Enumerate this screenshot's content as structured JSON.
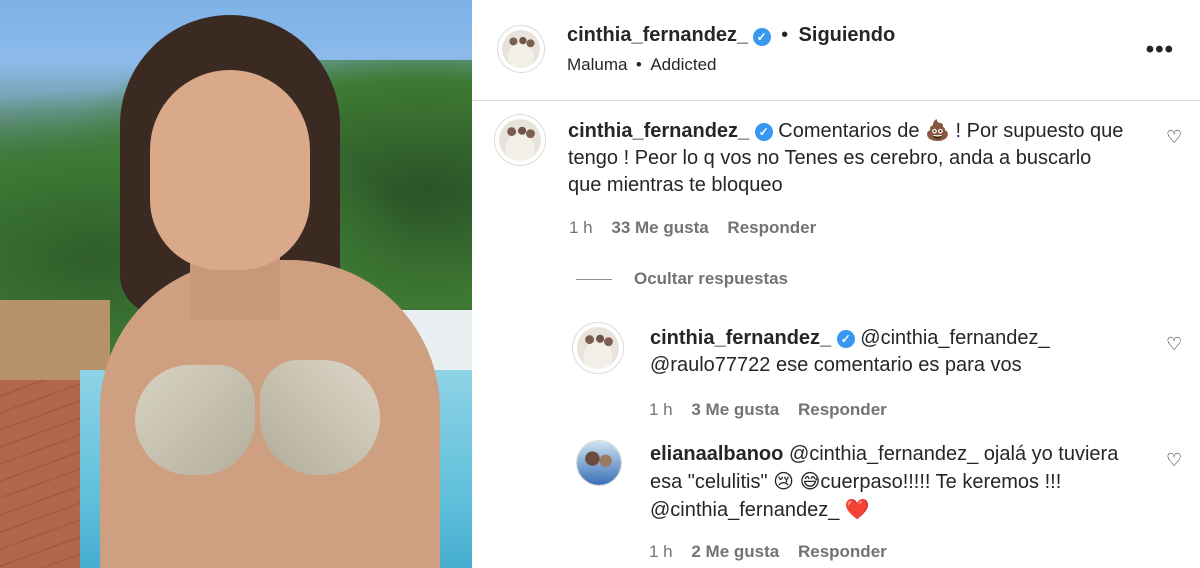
{
  "header": {
    "username": "cinthia_fernandez_",
    "separator": "•",
    "follow_label": "Siguiendo",
    "audio_artist": "Maluma",
    "audio_dot": "•",
    "audio_title": "Addicted",
    "more_label": "•••"
  },
  "comments": [
    {
      "username": "cinthia_fernandez_",
      "text_part1": "Comentarios de",
      "emoji1": "💩",
      "text_part2": "! Por supuesto que tengo ! Peor lo q vos no Tenes es cerebro, anda a buscarlo que mientras te bloqueo",
      "time": "1 h",
      "likes": "33 Me gusta",
      "reply": "Responder"
    }
  ],
  "replies_toggle": "Ocultar respuestas",
  "replies": [
    {
      "username": "cinthia_fernandez_",
      "text_part1": "@cinthia_fernandez_ @raulo77722 ese comentario es para vos",
      "time": "1 h",
      "likes": "3 Me gusta",
      "reply": "Responder"
    },
    {
      "username": "elianaalbanoo",
      "text_part1": "@cinthia_fernandez_ ojalá yo tuviera esa \"celulitis\"",
      "emoji1": "😢",
      "emoji2": "😅",
      "text_part2": "cuerpaso!!!!! Te keremos !!!",
      "text_part3": "@cinthia_fernandez_",
      "emoji3": "❤️",
      "time": "1 h",
      "likes": "2 Me gusta",
      "reply": "Responder"
    }
  ],
  "icons": {
    "verified": "✓",
    "heart": "♡"
  }
}
